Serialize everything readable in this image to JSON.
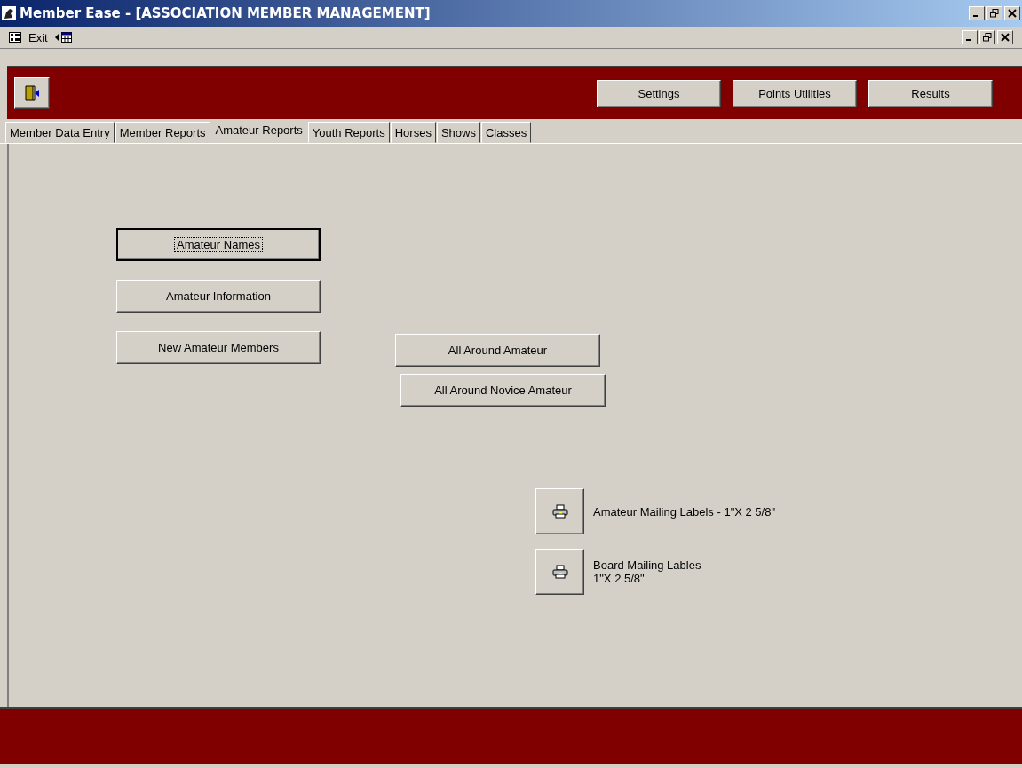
{
  "window": {
    "title": "Member Ease - [ASSOCIATION MEMBER MANAGEMENT]"
  },
  "menu": {
    "items": [
      "Exit"
    ]
  },
  "header": {
    "buttons": [
      "Settings",
      "Points Utilities",
      "Results"
    ]
  },
  "tabs": [
    {
      "label": "Member Data Entry",
      "selected": false
    },
    {
      "label": "Member Reports",
      "selected": false
    },
    {
      "label": "Amateur Reports",
      "selected": true
    },
    {
      "label": "Youth Reports",
      "selected": false
    },
    {
      "label": "Horses",
      "selected": false
    },
    {
      "label": "Shows",
      "selected": false
    },
    {
      "label": "Classes",
      "selected": false
    }
  ],
  "left_buttons": [
    {
      "label": "Amateur Names",
      "focused": true
    },
    {
      "label": "Amateur Information",
      "focused": false
    },
    {
      "label": "New Amateur Members",
      "focused": false
    }
  ],
  "middle_buttons": [
    {
      "label": "All Around Amateur",
      "focused": false
    },
    {
      "label": "All Around Novice Amateur",
      "focused": false
    }
  ],
  "print_buttons": [
    {
      "lines": [
        "Amateur Mailing Labels - 1\"X 2 5/8\""
      ]
    },
    {
      "lines": [
        "Board Mailing Lables",
        "1\"X 2 5/8\""
      ]
    }
  ]
}
